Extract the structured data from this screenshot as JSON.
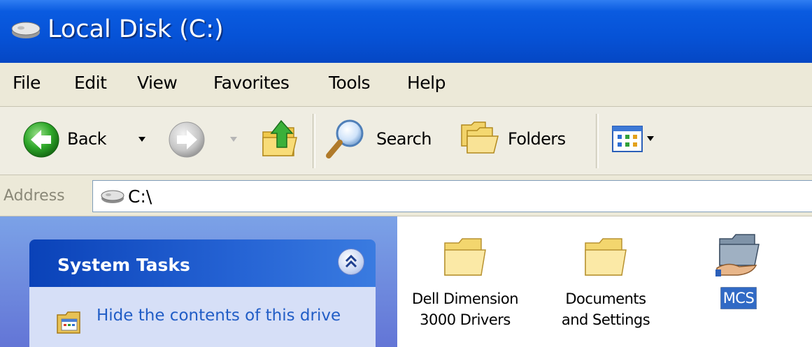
{
  "window": {
    "title": "Local Disk (C:)",
    "title_icon": "drive-icon"
  },
  "menu": {
    "items": [
      "File",
      "Edit",
      "View",
      "Favorites",
      "Tools",
      "Help"
    ]
  },
  "toolbar": {
    "back_label": "Back",
    "search_label": "Search",
    "folders_label": "Folders"
  },
  "address": {
    "label": "Address",
    "value": "C:\\"
  },
  "tasks": {
    "header": "System Tasks",
    "link": "Hide the contents of this drive"
  },
  "files": [
    {
      "name": "Dell Dimension 3000 Drivers",
      "line1": "Dell Dimension",
      "line2": "3000 Drivers",
      "icon": "folder-icon",
      "selected": false
    },
    {
      "name": "Documents and Settings",
      "line1": "Documents",
      "line2": "and Settings",
      "icon": "folder-icon",
      "selected": false
    },
    {
      "name": "MCS",
      "line1": "MCS",
      "line2": "",
      "icon": "shared-folder-icon",
      "selected": true
    }
  ],
  "colors": {
    "title_bar": "#0652d6",
    "menu_bg": "#ece9d8",
    "task_link": "#215dc6",
    "selection": "#316ac5"
  }
}
